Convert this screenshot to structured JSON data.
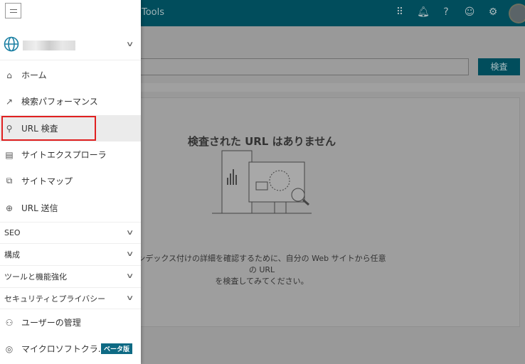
{
  "header": {
    "title": "Tools"
  },
  "main": {
    "search_button": "検査",
    "empty_title": "検査された URL はありません",
    "empty_desc_line1": "ンデックス付けの詳細を確認するために、自分の Web サイトから任意の URL",
    "empty_desc_line2": "を検査してみてください。"
  },
  "sidebar": {
    "items": [
      {
        "label": "ホーム",
        "icon": "home-icon"
      },
      {
        "label": "検索パフォーマンス",
        "icon": "trend-icon"
      },
      {
        "label": "URL 検査",
        "icon": "search-icon",
        "selected": true
      },
      {
        "label": "サイトエクスプローラ",
        "icon": "document-icon"
      },
      {
        "label": "サイトマップ",
        "icon": "sitemap-icon"
      },
      {
        "label": "URL 送信",
        "icon": "globe-icon"
      }
    ],
    "groups": [
      {
        "label": "SEO"
      },
      {
        "label": "構成"
      },
      {
        "label": "ツールと機能強化"
      },
      {
        "label": "セキュリティとプライバシー"
      }
    ],
    "bottom": [
      {
        "label": "ユーザーの管理",
        "icon": "users-icon"
      },
      {
        "label": "マイクロソフトクラ...",
        "icon": "clarity-icon",
        "badge": "ベータ版"
      }
    ]
  },
  "colors": {
    "header": "#004e5e",
    "highlight": "#e02020",
    "badge": "#0e6a84"
  }
}
